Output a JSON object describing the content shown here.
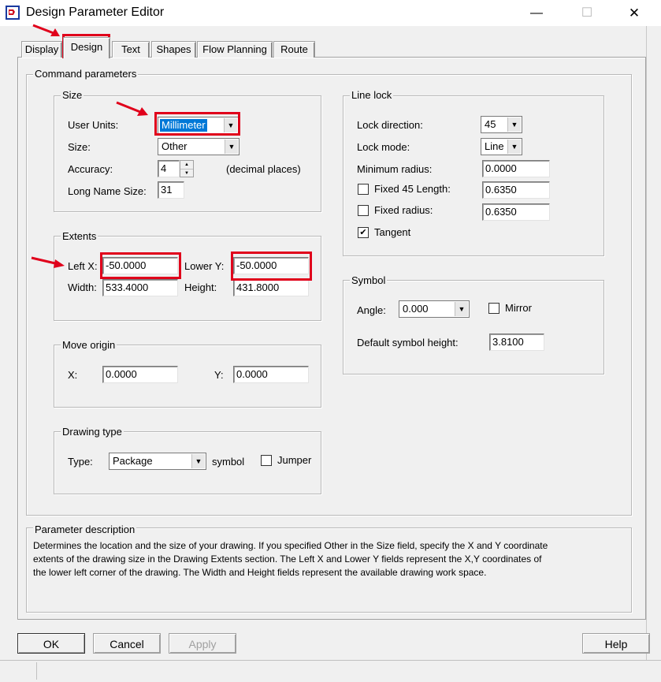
{
  "window": {
    "title": "Design Parameter Editor",
    "minimize": "—",
    "maximize": "☐",
    "close": "✕"
  },
  "tabs": [
    "Display",
    "Design",
    "Text",
    "Shapes",
    "Flow Planning",
    "Route"
  ],
  "command_parameters": {
    "label": "Command parameters",
    "size": {
      "label": "Size",
      "user_units_label": "User Units:",
      "user_units_value": "Millimeter",
      "size_label": "Size:",
      "size_value": "Other",
      "accuracy_label": "Accuracy:",
      "accuracy_value": "4",
      "accuracy_suffix": "(decimal places)",
      "long_name_label": "Long Name Size:",
      "long_name_value": "31"
    },
    "extents": {
      "label": "Extents",
      "left_x_label": "Left X:",
      "left_x_value": "-50.0000",
      "lower_y_label": "Lower Y:",
      "lower_y_value": "-50.0000",
      "width_label": "Width:",
      "width_value": "533.4000",
      "height_label": "Height:",
      "height_value": "431.8000"
    },
    "move_origin": {
      "label": "Move origin",
      "x_label": "X:",
      "x_value": "0.0000",
      "y_label": "Y:",
      "y_value": "0.0000"
    },
    "drawing_type": {
      "label": "Drawing type",
      "type_label": "Type:",
      "type_value": "Package",
      "symbol_label": "symbol",
      "jumper_label": "Jumper"
    },
    "line_lock": {
      "label": "Line lock",
      "lock_direction_label": "Lock direction:",
      "lock_direction_value": "45",
      "lock_mode_label": "Lock mode:",
      "lock_mode_value": "Line",
      "min_radius_label": "Minimum radius:",
      "min_radius_value": "0.0000",
      "fixed45_label": "Fixed 45 Length:",
      "fixed45_value": "0.6350",
      "fixed_radius_label": "Fixed radius:",
      "fixed_radius_value": "0.6350",
      "tangent_label": "Tangent",
      "tangent_checked": "✔"
    },
    "symbol": {
      "label": "Symbol",
      "angle_label": "Angle:",
      "angle_value": "0.000",
      "mirror_label": "Mirror",
      "default_height_label": "Default symbol height:",
      "default_height_value": "3.8100"
    }
  },
  "parameter_description": {
    "label": "Parameter description",
    "line1": "Determines the location and the size of your drawing.  If you specified Other in the Size field, specify the X and Y coordinate",
    "line2": "extents of the drawing size in the Drawing Extents section. The Left X and Lower Y fields represent the X,Y coordinates of",
    "line3": "the lower left corner of the drawing.  The Width and Height fields represent the available drawing work space."
  },
  "buttons": {
    "ok": "OK",
    "cancel": "Cancel",
    "apply": "Apply",
    "help": "Help"
  },
  "colors": {
    "highlight": "#e0001b",
    "selection": "#0078d7"
  },
  "icons": {
    "dropdown": "▼",
    "spin_up": "▲",
    "spin_down": "▼"
  }
}
